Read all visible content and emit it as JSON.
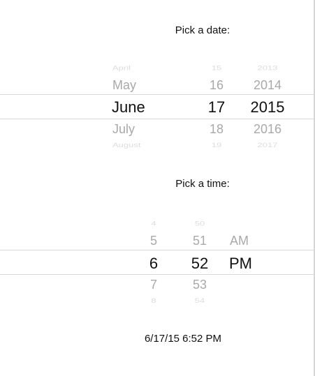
{
  "date_section": {
    "label": "Pick a date:",
    "months": [
      "April",
      "May",
      "June",
      "July",
      "August"
    ],
    "days": [
      "15",
      "16",
      "17",
      "18",
      "19"
    ],
    "years": [
      "2013",
      "2014",
      "2015",
      "2016",
      "2017"
    ],
    "selected": {
      "month": "June",
      "day": "17",
      "year": "2015"
    }
  },
  "time_section": {
    "label": "Pick a time:",
    "hours": [
      "4",
      "5",
      "6",
      "7",
      "8"
    ],
    "minutes": [
      "50",
      "51",
      "52",
      "53",
      "54"
    ],
    "periods": [
      "AM",
      "PM"
    ],
    "selected": {
      "hour": "6",
      "minute": "52",
      "period": "PM"
    }
  },
  "result": {
    "text": "6/17/15 6:52 PM"
  }
}
